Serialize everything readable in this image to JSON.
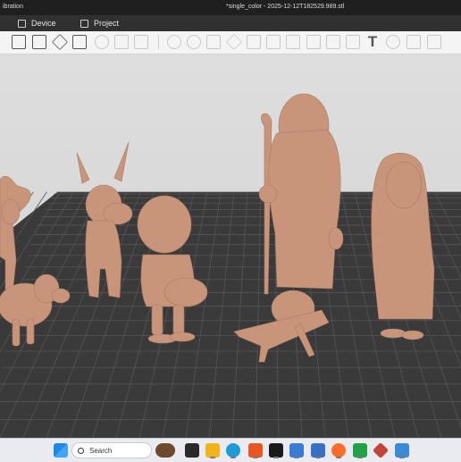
{
  "titlebar": {
    "left_text": "ibration",
    "window_title": "*single_color - 2025-12-12T182529.989.stl"
  },
  "tabs": [
    {
      "label": "Device",
      "icon": "device-icon"
    },
    {
      "label": "Project",
      "icon": "project-icon"
    }
  ],
  "toolbar": {
    "tools": [
      "add-object-icon",
      "grid-icon",
      "orient-icon",
      "arrange-icon",
      "split-objects-icon",
      "split-parts-icon",
      "layers-icon",
      "move-icon",
      "rotate-icon",
      "scale-icon",
      "lay-on-face-icon",
      "cut-icon",
      "boolean-icon",
      "support-paint-icon",
      "seam-paint-icon",
      "color-paint-icon",
      "measure-icon",
      "text-icon",
      "emboss-icon",
      "assembly-icon",
      "fit-view-icon"
    ]
  },
  "scene": {
    "plate_color": "#3a3a3a",
    "grid_line_color": "#555555",
    "model_color": "#c8957a",
    "figures": [
      "camel",
      "sheep",
      "donkey",
      "drummer-boy",
      "shepherd-with-staff",
      "baby-in-manger",
      "mary"
    ]
  },
  "taskbar": {
    "search_placeholder": "Search",
    "apps": [
      "windows-start-icon",
      "task-view-icon",
      "file-explorer-icon",
      "edge-icon",
      "office-icon",
      "bambu-studio-icon",
      "store-icon",
      "calculator-icon",
      "firefox-icon",
      "app-green-icon",
      "app-red-icon",
      "app-blue-icon"
    ]
  }
}
